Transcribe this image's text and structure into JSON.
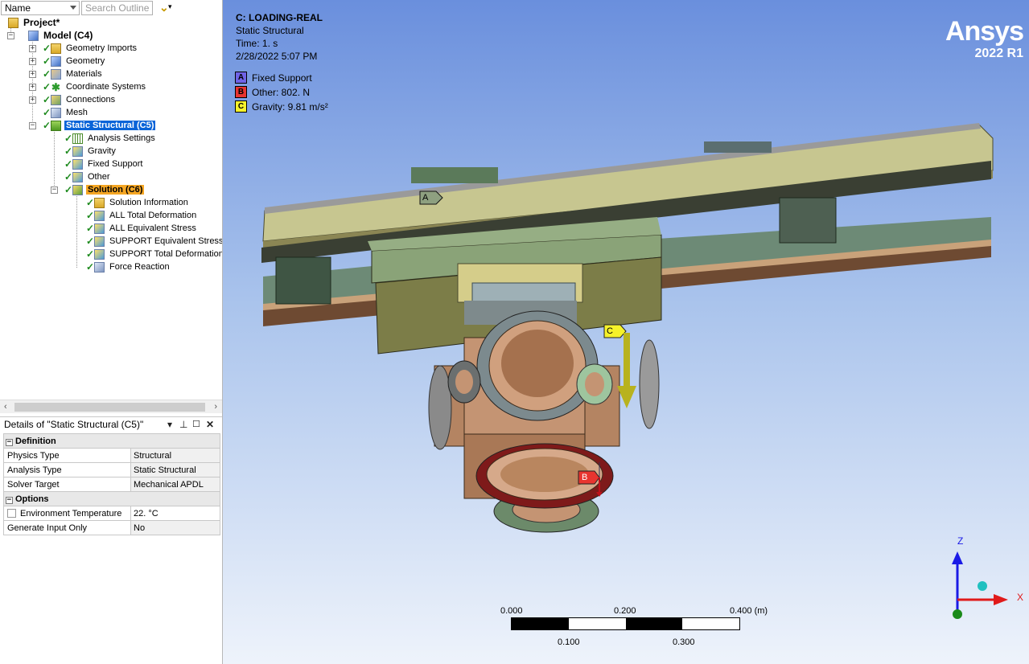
{
  "toolbar": {
    "name_filter": "Name",
    "search_placeholder": "Search Outline"
  },
  "tree": {
    "project": "Project*",
    "model": "Model (C4)",
    "model_children": [
      "Geometry Imports",
      "Geometry",
      "Materials",
      "Coordinate Systems",
      "Connections",
      "Mesh"
    ],
    "static": "Static Structural (C5)",
    "static_children": [
      "Analysis Settings",
      "Gravity",
      "Fixed Support",
      "Other"
    ],
    "solution": "Solution (C6)",
    "solution_children": [
      "Solution Information",
      "ALL Total Deformation",
      "ALL Equivalent Stress",
      "SUPPORT Equivalent Stress",
      "SUPPORT Total Deformation",
      "Force Reaction"
    ]
  },
  "details": {
    "title": "Details of \"Static Structural (C5)\"",
    "sections": [
      {
        "name": "Definition",
        "rows": [
          [
            "Physics Type",
            "Structural"
          ],
          [
            "Analysis Type",
            "Static Structural"
          ],
          [
            "Solver Target",
            "Mechanical APDL"
          ]
        ]
      },
      {
        "name": "Options",
        "rows": [
          [
            "Environment Temperature",
            "22. °C"
          ],
          [
            "Generate Input Only",
            "No"
          ]
        ]
      }
    ]
  },
  "viewport": {
    "title": "C: LOADING-REAL",
    "subtitle": "Static Structural",
    "time": "Time: 1. s",
    "date": "2/28/2022 5:07 PM",
    "legend": [
      {
        "key": "A",
        "label": "Fixed Support",
        "color": "#6f63e6"
      },
      {
        "key": "B",
        "label": "Other: 802. N",
        "color": "#e8342f"
      },
      {
        "key": "C",
        "label": "Gravity: 9.81 m/s²",
        "color": "#f6f22a"
      }
    ],
    "brand": "Ansys",
    "version": "2022 R1",
    "scale": {
      "top": [
        "0.000",
        "0.200",
        "0.400 (m)"
      ],
      "bottom": [
        "0.100",
        "0.300"
      ]
    },
    "axes": {
      "z": "Z",
      "x": "X"
    },
    "markers": {
      "a": "A",
      "b": "B",
      "c": "C"
    }
  }
}
